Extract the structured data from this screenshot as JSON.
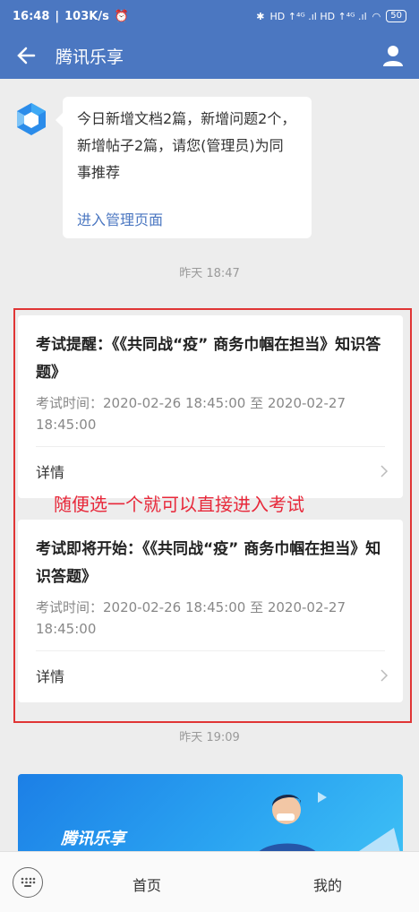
{
  "status_bar": {
    "time": "16:48",
    "speed": "103K/s",
    "signal": "HD ↑⁴ᴳ .ıl  HD ↑⁴ᴳ .ıl",
    "battery": "50"
  },
  "header": {
    "title": "腾讯乐享"
  },
  "message": {
    "text": "今日新增文档2篇，新增问题2个，新增帖子2篇，请您(管理员)为同事推荐",
    "link": "进入管理页面"
  },
  "timestamps": [
    "昨天  18:47",
    "昨天  19:09"
  ],
  "cards": [
    {
      "title": "考试提醒：《《共同战“疫” 商务巾帼在担当》知识答题》",
      "info": "考试时间：2020-02-26 18:45:00 至 2020-02-27 18:45:00",
      "detail": "详情"
    },
    {
      "title": "考试即将开始：《《共同战“疫” 商务巾帼在担当》知识答题》",
      "info": "考试时间：2020-02-26 18:45:00 至 2020-02-27 18:45:00",
      "detail": "详情"
    }
  ],
  "annotation": "随便选一个就可以直接进入考试",
  "banner": {
    "text": "腾讯乐享"
  },
  "tabbar": {
    "home": "首页",
    "mine": "我的"
  },
  "colors": {
    "brand": "#4b77c1",
    "annotation": "#e03535"
  }
}
